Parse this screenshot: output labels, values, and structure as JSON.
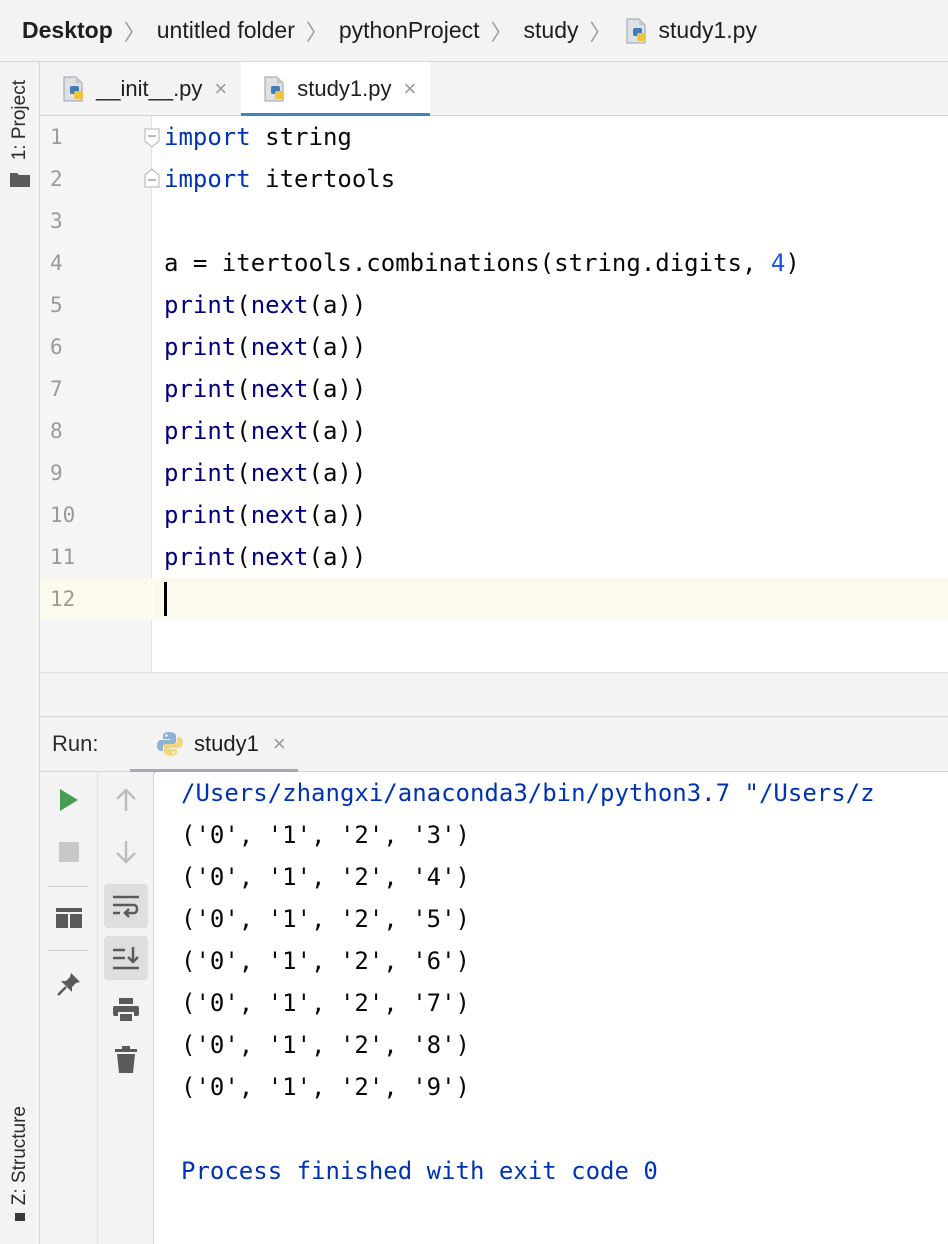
{
  "breadcrumb": {
    "items": [
      "Desktop",
      "untitled folder",
      "pythonProject",
      "study",
      "study1.py"
    ],
    "separator": "〉"
  },
  "left_strip": {
    "project_tab": "1: Project",
    "structure_tab": "Z: Structure"
  },
  "editor_tabs": [
    {
      "label": "__init__.py",
      "active": false,
      "close": "×"
    },
    {
      "label": "study1.py",
      "active": true,
      "close": "×"
    }
  ],
  "editor": {
    "line_numbers": [
      "1",
      "2",
      "3",
      "4",
      "5",
      "6",
      "7",
      "8",
      "9",
      "10",
      "11",
      "12"
    ],
    "current_line": 12,
    "lines": [
      [
        {
          "t": "import",
          "c": "kw"
        },
        {
          "t": " string",
          "c": ""
        }
      ],
      [
        {
          "t": "import",
          "c": "kw"
        },
        {
          "t": " itertools",
          "c": ""
        }
      ],
      [],
      [
        {
          "t": "a = itertools.combinations(string.digits, ",
          "c": ""
        },
        {
          "t": "4",
          "c": "num"
        },
        {
          "t": ")",
          "c": ""
        }
      ],
      [
        {
          "t": "print",
          "c": "bi"
        },
        {
          "t": "(",
          "c": ""
        },
        {
          "t": "next",
          "c": "bi"
        },
        {
          "t": "(a))",
          "c": ""
        }
      ],
      [
        {
          "t": "print",
          "c": "bi"
        },
        {
          "t": "(",
          "c": ""
        },
        {
          "t": "next",
          "c": "bi"
        },
        {
          "t": "(a))",
          "c": ""
        }
      ],
      [
        {
          "t": "print",
          "c": "bi"
        },
        {
          "t": "(",
          "c": ""
        },
        {
          "t": "next",
          "c": "bi"
        },
        {
          "t": "(a))",
          "c": ""
        }
      ],
      [
        {
          "t": "print",
          "c": "bi"
        },
        {
          "t": "(",
          "c": ""
        },
        {
          "t": "next",
          "c": "bi"
        },
        {
          "t": "(a))",
          "c": ""
        }
      ],
      [
        {
          "t": "print",
          "c": "bi"
        },
        {
          "t": "(",
          "c": ""
        },
        {
          "t": "next",
          "c": "bi"
        },
        {
          "t": "(a))",
          "c": ""
        }
      ],
      [
        {
          "t": "print",
          "c": "bi"
        },
        {
          "t": "(",
          "c": ""
        },
        {
          "t": "next",
          "c": "bi"
        },
        {
          "t": "(a))",
          "c": ""
        }
      ],
      [
        {
          "t": "print",
          "c": "bi"
        },
        {
          "t": "(",
          "c": ""
        },
        {
          "t": "next",
          "c": "bi"
        },
        {
          "t": "(a))",
          "c": ""
        }
      ],
      []
    ]
  },
  "run_panel": {
    "label": "Run:",
    "tab_label": "study1",
    "tab_close": "×",
    "output": [
      "/Users/zhangxi/anaconda3/bin/python3.7 \"/Users/z",
      "('0', '1', '2', '3')",
      "('0', '1', '2', '4')",
      "('0', '1', '2', '5')",
      "('0', '1', '2', '6')",
      "('0', '1', '2', '7')",
      "('0', '1', '2', '8')",
      "('0', '1', '2', '9')",
      "",
      "Process finished with exit code 0"
    ],
    "toolbar_left": [
      "run-icon",
      "stop-icon",
      "layout-icon",
      "pin-icon"
    ],
    "toolbar_right": [
      "up-arrow-icon",
      "down-arrow-icon",
      "soft-wrap-icon",
      "scroll-to-end-icon",
      "print-icon",
      "trash-icon"
    ]
  },
  "colors": {
    "keyword": "#0033b3",
    "builtin": "#000080",
    "number": "#1750eb",
    "tab_underline": "#4083c9",
    "run_green": "#499c54"
  }
}
